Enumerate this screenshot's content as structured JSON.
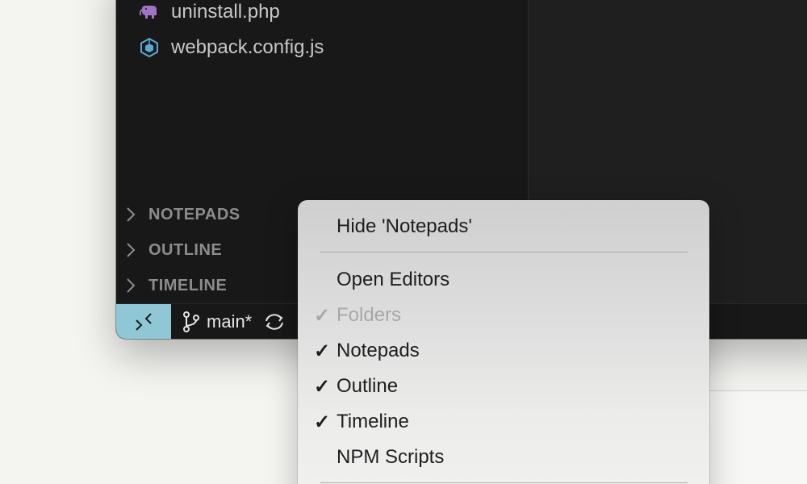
{
  "files": [
    {
      "name": "uninstall.php",
      "icon": "php-elephant-icon",
      "icon_color": "#a074c4"
    },
    {
      "name": "webpack.config.js",
      "icon": "webpack-cube-icon",
      "icon_color": "#5aa8d8"
    }
  ],
  "sections": [
    {
      "label": "NOTEPADS"
    },
    {
      "label": "OUTLINE"
    },
    {
      "label": "TIMELINE"
    }
  ],
  "statusbar": {
    "branch": "main*",
    "remote_color": "#8fc7d6"
  },
  "context_menu": {
    "items": [
      {
        "label": "Hide 'Notepads'",
        "checked": false,
        "disabled": false
      },
      {
        "separator": true
      },
      {
        "label": "Open Editors",
        "checked": false,
        "disabled": false
      },
      {
        "label": "Folders",
        "checked": true,
        "disabled": true
      },
      {
        "label": "Notepads",
        "checked": true,
        "disabled": false
      },
      {
        "label": "Outline",
        "checked": true,
        "disabled": false
      },
      {
        "label": "Timeline",
        "checked": true,
        "disabled": false
      },
      {
        "label": "NPM Scripts",
        "checked": false,
        "disabled": false
      },
      {
        "separator": true
      }
    ],
    "check_glyph": "✓"
  }
}
